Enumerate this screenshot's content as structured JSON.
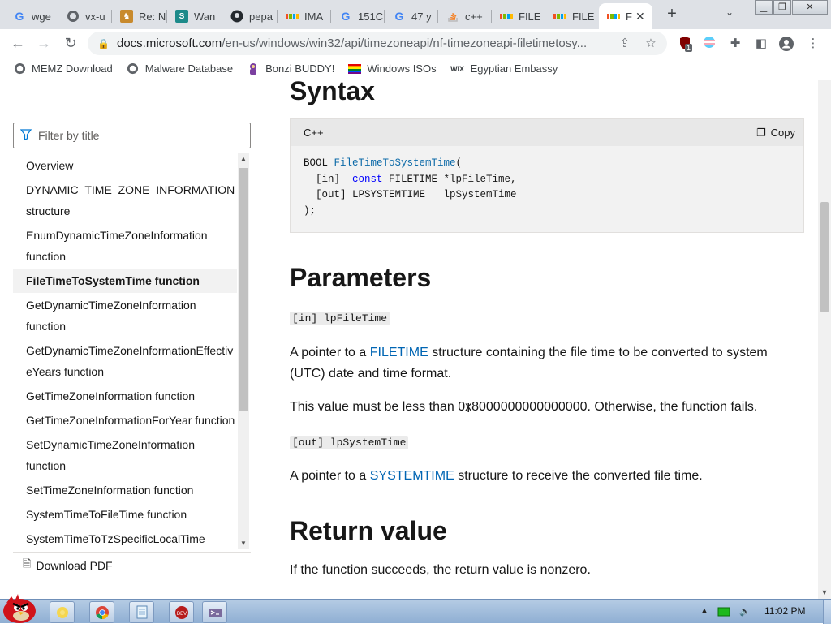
{
  "browser": {
    "tabs": [
      {
        "label": "wge",
        "favicon": "google-icon"
      },
      {
        "label": "vx-u",
        "favicon": "globe-icon"
      },
      {
        "label": "Re: N",
        "favicon": "stackexchange-icon"
      },
      {
        "label": "Wan",
        "favicon": "stackoverflow-s-icon"
      },
      {
        "label": "pepa",
        "favicon": "github-icon"
      },
      {
        "label": "IMA",
        "favicon": "microsoft-icon"
      },
      {
        "label": "151C",
        "favicon": "google-icon"
      },
      {
        "label": "47 y",
        "favicon": "google-icon"
      },
      {
        "label": "c++",
        "favicon": "stackoverflow-icon"
      },
      {
        "label": "FILE",
        "favicon": "microsoft-icon"
      },
      {
        "label": "FILE",
        "favicon": "microsoft-icon"
      },
      {
        "label": "F",
        "favicon": "microsoft-icon",
        "active": true
      }
    ],
    "url_host": "docs.microsoft.com",
    "url_path": "/en-us/windows/win32/api/timezoneapi/nf-timezoneapi-filetimetosy...",
    "extension_badge": "1",
    "bookmarks": [
      {
        "label": "MEMZ Download",
        "icon": "globe-icon"
      },
      {
        "label": "Malware Database",
        "icon": "globe-icon"
      },
      {
        "label": "Bonzi BUDDY!",
        "icon": "bonzi-icon"
      },
      {
        "label": "Windows ISOs",
        "icon": "rainbow-flag-icon"
      },
      {
        "label": "Egyptian Embassy",
        "icon": "wix-icon"
      }
    ]
  },
  "sidebar": {
    "filter_placeholder": "Filter by title",
    "items": [
      {
        "label": "Overview"
      },
      {
        "label": "DYNAMIC_TIME_ZONE_INFORMATION structure"
      },
      {
        "label": "EnumDynamicTimeZoneInformation function"
      },
      {
        "label": "FileTimeToSystemTime function",
        "selected": true
      },
      {
        "label": "GetDynamicTimeZoneInformation function"
      },
      {
        "label": "GetDynamicTimeZoneInformationEffectiveYears function"
      },
      {
        "label": "GetTimeZoneInformation function"
      },
      {
        "label": "GetTimeZoneInformationForYear function"
      },
      {
        "label": "SetDynamicTimeZoneInformation function"
      },
      {
        "label": "SetTimeZoneInformation function"
      },
      {
        "label": "SystemTimeToFileTime function"
      },
      {
        "label": "SystemTimeToTzSpecificLocalTime"
      }
    ],
    "download_pdf": "Download PDF"
  },
  "article": {
    "syntax_heading": "Syntax",
    "code_lang": "C++",
    "copy_label": "Copy",
    "code": {
      "line1_type": "BOOL ",
      "line1_fn": "FileTimeToSystemTime",
      "line1_end": "(",
      "line2_pre": "  [in]  ",
      "line2_kw": "const",
      "line2_post": " FILETIME *lpFileTime,",
      "line3": "  [out] LPSYSTEMTIME   lpSystemTime",
      "line4": ");"
    },
    "parameters_heading": "Parameters",
    "param1_name": "[in] lpFileTime",
    "param1_desc_pre": "A pointer to a ",
    "param1_link": "FILETIME",
    "param1_desc_post": " structure containing the file time to be converted to system (UTC) date and time format.",
    "param1_note": "This value must be less than 0x8000000000000000. Otherwise, the function fails.",
    "param2_name": "[out] lpSystemTime",
    "param2_desc_pre": "A pointer to a ",
    "param2_link": "SYSTEMTIME",
    "param2_desc_post": " structure to receive the converted file time.",
    "return_heading": "Return value",
    "return_desc": "If the function succeeds, the return value is nonzero."
  },
  "taskbar": {
    "clock": "11:02 PM",
    "pinned": [
      "folder-icon",
      "chrome-icon",
      "notepad-icon",
      "devcpp-icon",
      "visual-studio-icon"
    ]
  },
  "colors": {
    "link": "#0065b3",
    "ms_red": "#f25022",
    "ms_green": "#7fba00",
    "ms_blue": "#00a4ef",
    "ms_yellow": "#ffb900"
  }
}
